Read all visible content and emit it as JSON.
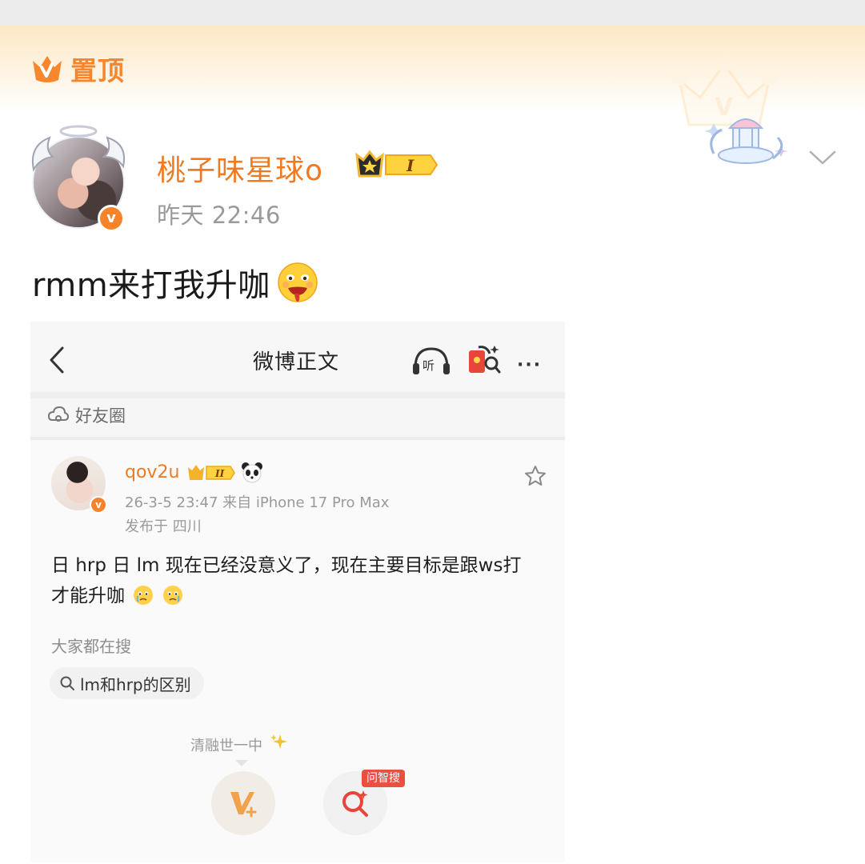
{
  "pinned": {
    "label": "置顶",
    "icon": "crown-v-icon"
  },
  "author": {
    "name": "桃子味星球o",
    "vip_level": "I",
    "time": "昨天 22:46",
    "verified_icon": "v"
  },
  "post": {
    "text": "rmm来打我升咖",
    "emoji": "drooling-face-emoji"
  },
  "embedded": {
    "title": "微博正文",
    "more": "···",
    "circle_label": "好友圈",
    "user": {
      "name": "qov2u",
      "vip_level": "II",
      "verified_icon": "v",
      "meta": "26-3-5 23:47  来自 iPhone 17 Pro Max",
      "location": "发布于 四川"
    },
    "body": "日 hrp 日 lm 现在已经没意义了，现在主要目标是跟ws打才能升咖",
    "search_title": "大家都在搜",
    "search_chip": "lm和hrp的区别",
    "tip": "清融世一中",
    "ask_badge": "问智搜"
  },
  "colors": {
    "brand_orange": "#f07a22",
    "banner_top": "#fde8c6",
    "meta_gray": "#9a9a9a",
    "badge_red": "#ea4f3f"
  }
}
